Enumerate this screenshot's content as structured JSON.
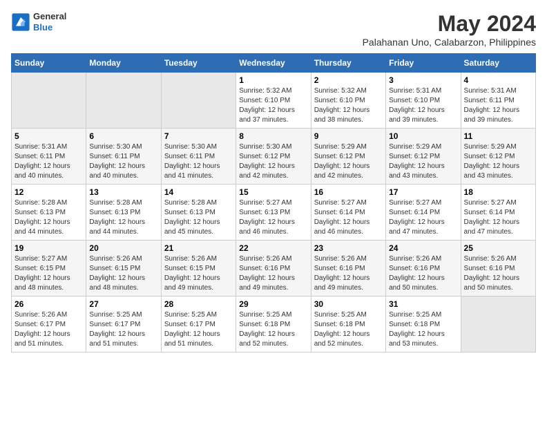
{
  "header": {
    "logo_line1": "General",
    "logo_line2": "Blue",
    "title": "May 2024",
    "subtitle": "Palahanan Uno, Calabarzon, Philippines"
  },
  "days_of_week": [
    "Sunday",
    "Monday",
    "Tuesday",
    "Wednesday",
    "Thursday",
    "Friday",
    "Saturday"
  ],
  "weeks": [
    [
      {
        "day": "",
        "info": ""
      },
      {
        "day": "",
        "info": ""
      },
      {
        "day": "",
        "info": ""
      },
      {
        "day": "1",
        "info": "Sunrise: 5:32 AM\nSunset: 6:10 PM\nDaylight: 12 hours\nand 37 minutes."
      },
      {
        "day": "2",
        "info": "Sunrise: 5:32 AM\nSunset: 6:10 PM\nDaylight: 12 hours\nand 38 minutes."
      },
      {
        "day": "3",
        "info": "Sunrise: 5:31 AM\nSunset: 6:10 PM\nDaylight: 12 hours\nand 39 minutes."
      },
      {
        "day": "4",
        "info": "Sunrise: 5:31 AM\nSunset: 6:11 PM\nDaylight: 12 hours\nand 39 minutes."
      }
    ],
    [
      {
        "day": "5",
        "info": "Sunrise: 5:31 AM\nSunset: 6:11 PM\nDaylight: 12 hours\nand 40 minutes."
      },
      {
        "day": "6",
        "info": "Sunrise: 5:30 AM\nSunset: 6:11 PM\nDaylight: 12 hours\nand 40 minutes."
      },
      {
        "day": "7",
        "info": "Sunrise: 5:30 AM\nSunset: 6:11 PM\nDaylight: 12 hours\nand 41 minutes."
      },
      {
        "day": "8",
        "info": "Sunrise: 5:30 AM\nSunset: 6:12 PM\nDaylight: 12 hours\nand 42 minutes."
      },
      {
        "day": "9",
        "info": "Sunrise: 5:29 AM\nSunset: 6:12 PM\nDaylight: 12 hours\nand 42 minutes."
      },
      {
        "day": "10",
        "info": "Sunrise: 5:29 AM\nSunset: 6:12 PM\nDaylight: 12 hours\nand 43 minutes."
      },
      {
        "day": "11",
        "info": "Sunrise: 5:29 AM\nSunset: 6:12 PM\nDaylight: 12 hours\nand 43 minutes."
      }
    ],
    [
      {
        "day": "12",
        "info": "Sunrise: 5:28 AM\nSunset: 6:13 PM\nDaylight: 12 hours\nand 44 minutes."
      },
      {
        "day": "13",
        "info": "Sunrise: 5:28 AM\nSunset: 6:13 PM\nDaylight: 12 hours\nand 44 minutes."
      },
      {
        "day": "14",
        "info": "Sunrise: 5:28 AM\nSunset: 6:13 PM\nDaylight: 12 hours\nand 45 minutes."
      },
      {
        "day": "15",
        "info": "Sunrise: 5:27 AM\nSunset: 6:13 PM\nDaylight: 12 hours\nand 46 minutes."
      },
      {
        "day": "16",
        "info": "Sunrise: 5:27 AM\nSunset: 6:14 PM\nDaylight: 12 hours\nand 46 minutes."
      },
      {
        "day": "17",
        "info": "Sunrise: 5:27 AM\nSunset: 6:14 PM\nDaylight: 12 hours\nand 47 minutes."
      },
      {
        "day": "18",
        "info": "Sunrise: 5:27 AM\nSunset: 6:14 PM\nDaylight: 12 hours\nand 47 minutes."
      }
    ],
    [
      {
        "day": "19",
        "info": "Sunrise: 5:27 AM\nSunset: 6:15 PM\nDaylight: 12 hours\nand 48 minutes."
      },
      {
        "day": "20",
        "info": "Sunrise: 5:26 AM\nSunset: 6:15 PM\nDaylight: 12 hours\nand 48 minutes."
      },
      {
        "day": "21",
        "info": "Sunrise: 5:26 AM\nSunset: 6:15 PM\nDaylight: 12 hours\nand 49 minutes."
      },
      {
        "day": "22",
        "info": "Sunrise: 5:26 AM\nSunset: 6:16 PM\nDaylight: 12 hours\nand 49 minutes."
      },
      {
        "day": "23",
        "info": "Sunrise: 5:26 AM\nSunset: 6:16 PM\nDaylight: 12 hours\nand 49 minutes."
      },
      {
        "day": "24",
        "info": "Sunrise: 5:26 AM\nSunset: 6:16 PM\nDaylight: 12 hours\nand 50 minutes."
      },
      {
        "day": "25",
        "info": "Sunrise: 5:26 AM\nSunset: 6:16 PM\nDaylight: 12 hours\nand 50 minutes."
      }
    ],
    [
      {
        "day": "26",
        "info": "Sunrise: 5:26 AM\nSunset: 6:17 PM\nDaylight: 12 hours\nand 51 minutes."
      },
      {
        "day": "27",
        "info": "Sunrise: 5:25 AM\nSunset: 6:17 PM\nDaylight: 12 hours\nand 51 minutes."
      },
      {
        "day": "28",
        "info": "Sunrise: 5:25 AM\nSunset: 6:17 PM\nDaylight: 12 hours\nand 51 minutes."
      },
      {
        "day": "29",
        "info": "Sunrise: 5:25 AM\nSunset: 6:18 PM\nDaylight: 12 hours\nand 52 minutes."
      },
      {
        "day": "30",
        "info": "Sunrise: 5:25 AM\nSunset: 6:18 PM\nDaylight: 12 hours\nand 52 minutes."
      },
      {
        "day": "31",
        "info": "Sunrise: 5:25 AM\nSunset: 6:18 PM\nDaylight: 12 hours\nand 53 minutes."
      },
      {
        "day": "",
        "info": ""
      }
    ]
  ]
}
